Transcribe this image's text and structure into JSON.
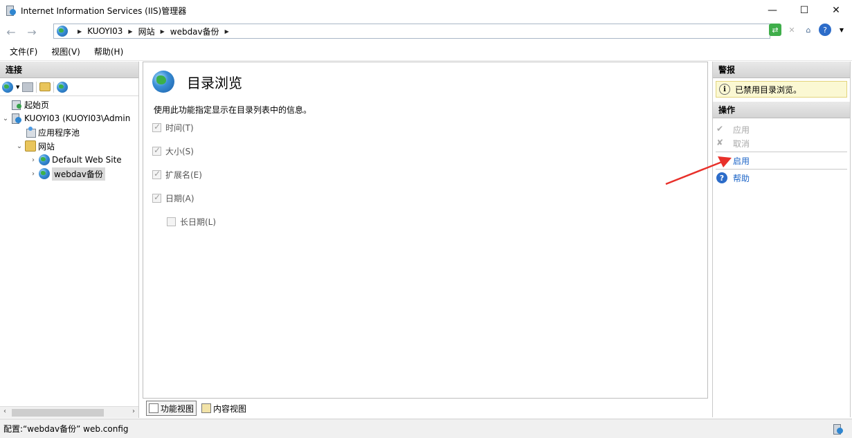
{
  "window": {
    "title": "Internet Information Services (IIS)管理器",
    "minimize": "—",
    "maximize": "☐",
    "close": "✕"
  },
  "address": {
    "crumbs": [
      "KUOYI03",
      "网站",
      "webdav备份"
    ]
  },
  "menu": {
    "items": [
      "文件(F)",
      "视图(V)",
      "帮助(H)"
    ]
  },
  "left": {
    "header": "连接",
    "tree": [
      {
        "label": "起始页",
        "level": 0,
        "icon": "home-page-icon"
      },
      {
        "label": "KUOYI03 (KUOYI03\\Admin",
        "level": 0,
        "icon": "server-icon",
        "expanded": true
      },
      {
        "label": "应用程序池",
        "level": 1,
        "icon": "app-pool-icon"
      },
      {
        "label": "网站",
        "level": 1,
        "icon": "folder-icon",
        "expanded": true
      },
      {
        "label": "Default Web Site",
        "level": 2,
        "icon": "globe-icon"
      },
      {
        "label": "webdav备份",
        "level": 2,
        "icon": "globe-icon",
        "selected": true
      }
    ]
  },
  "center": {
    "title": "目录浏览",
    "description": "使用此功能指定显示在目录列表中的信息。",
    "options": [
      {
        "label": "时间(T)",
        "checked": true
      },
      {
        "label": "大小(S)",
        "checked": true
      },
      {
        "label": "扩展名(E)",
        "checked": true
      },
      {
        "label": "日期(A)",
        "checked": true
      },
      {
        "label": "长日期(L)",
        "checked": false
      }
    ],
    "tabs": [
      "功能视图",
      "内容视图"
    ]
  },
  "right": {
    "alerts_header": "警报",
    "alert_text": "已禁用目录浏览。",
    "actions_header": "操作",
    "actions": {
      "apply": "应用",
      "cancel": "取消",
      "enable": "启用",
      "help": "帮助"
    }
  },
  "status": {
    "text": "配置:“webdav备份” web.config"
  },
  "colors": {
    "link": "#1b64c7",
    "annotation_arrow": "#e8302a",
    "alert_bg": "#fbf8d3"
  }
}
